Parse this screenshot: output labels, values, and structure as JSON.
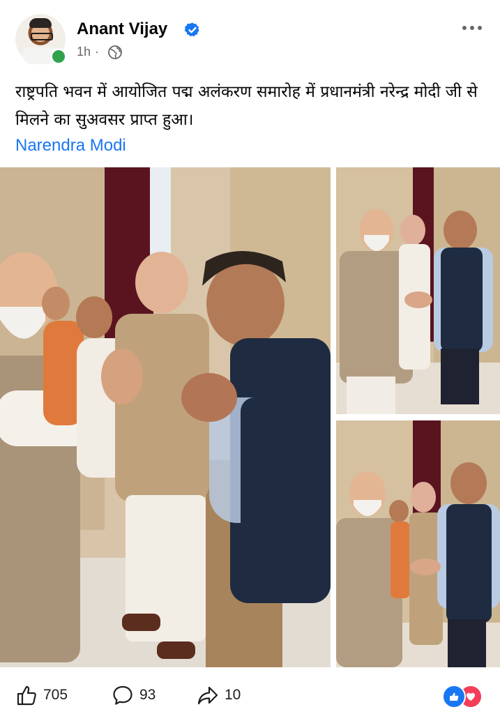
{
  "post": {
    "author": "Anant Vijay",
    "time": "1h",
    "separator": "·",
    "text": "राष्ट्रपति भवन में आयोजित पद्म अलंकरण समारोह में प्रधानमंत्री नरेन्द्र मोदी जी से मिलने का सुअवसर प्राप्त हुआ।",
    "tag": "Narendra Modi"
  },
  "icons": {
    "verified": "verified-badge-icon",
    "audience": "globe-icon",
    "more": "more-options-icon",
    "like": "thumbs-up-icon",
    "comment": "comment-bubble-icon",
    "share": "share-arrow-icon"
  },
  "stats": {
    "likes": "705",
    "comments": "93",
    "shares": "10"
  },
  "colors": {
    "link": "#1877f2",
    "verified": "#1877f2",
    "online": "#31a24c",
    "like_reaction": "#1877f2",
    "love_reaction": "#f33e58"
  }
}
